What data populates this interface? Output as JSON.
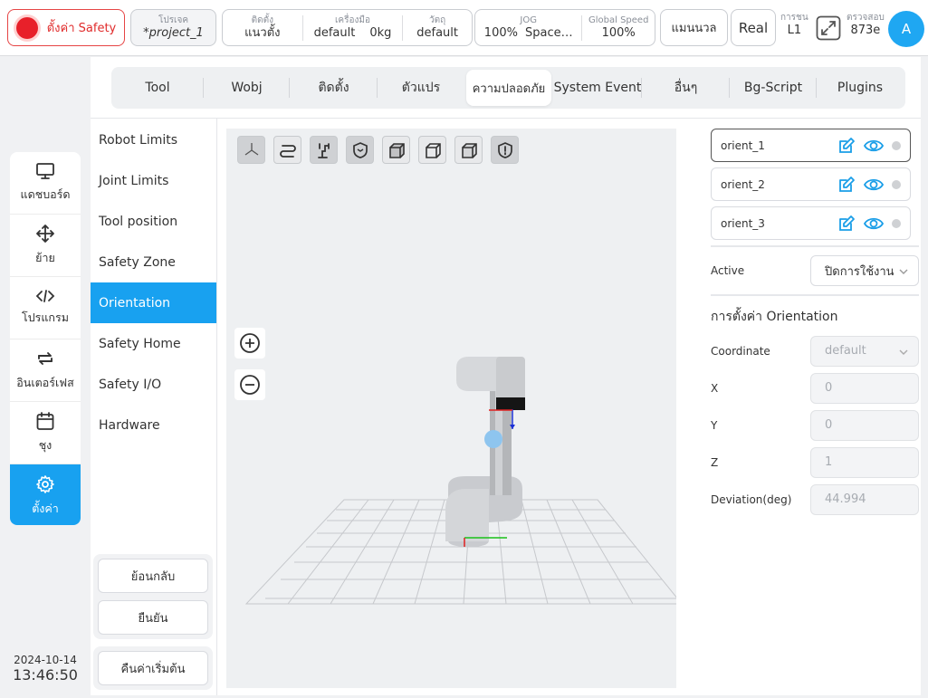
{
  "topbar": {
    "safety_label": "ตั้งค่า Safety",
    "project_label": "โปรเจค",
    "project_value": "*project_1",
    "install_label": "ติดตั้ง",
    "install_value": "แนวตั้ง",
    "tool_label": "เครื่องมือ",
    "tool_value": "default",
    "tool_weight": "0kg",
    "object_label": "วัตถุ",
    "object_value": "default",
    "jog_label": "JOG",
    "jog_value": "100%",
    "jog_key": "Space…",
    "speed_label": "Global Speed",
    "speed_value": "100%",
    "mode_label": "แมนนวล",
    "real_label": "Real",
    "level_label": "การชน",
    "level_value": "L1",
    "verify_label": "ตรวจสอบ",
    "verify_value": "873e",
    "avatar_letter": "A"
  },
  "leftnav": {
    "items": [
      {
        "label": "แดชบอร์ด",
        "icon": "monitor-icon"
      },
      {
        "label": "ย้าย",
        "icon": "move-icon"
      },
      {
        "label": "โปรแกรม",
        "icon": "code-icon"
      },
      {
        "label": "อินเตอร์เฟส",
        "icon": "swap-icon"
      },
      {
        "label": "ชุง",
        "icon": "calendar-icon"
      },
      {
        "label": "ตั้งค่า",
        "icon": "gear-icon"
      }
    ],
    "date": "2024-10-14",
    "time": "13:46:50"
  },
  "tabs": [
    "Tool",
    "Wobj",
    "ติดตั้ง",
    "ตัวแปร",
    "ความปลอดภัย",
    "System Event",
    "อื่นๆ",
    "Bg-Script",
    "Plugins"
  ],
  "submenu": [
    "Robot Limits",
    "Joint Limits",
    "Tool position",
    "Safety Zone",
    "Orientation",
    "Safety Home",
    "Safety I/O",
    "Hardware"
  ],
  "buttons": {
    "back": "ย้อนกลับ",
    "confirm": "ยืนยัน",
    "reset": "คืนค่าเริ่มต้น"
  },
  "orientations": [
    "orient_1",
    "orient_2",
    "orient_3"
  ],
  "settings": {
    "active_label": "Active",
    "active_value": "ปิดการใช้งาน",
    "section_title": "การตั้งค่า Orientation",
    "coordinate_label": "Coordinate",
    "coordinate_value": "default",
    "x_label": "X",
    "x_value": "0",
    "y_label": "Y",
    "y_value": "0",
    "z_label": "Z",
    "z_value": "1",
    "deviation_label": "Deviation(deg)",
    "deviation_value": "44.994"
  },
  "colors": {
    "accent": "#18a1f0",
    "danger": "#e8202a"
  }
}
